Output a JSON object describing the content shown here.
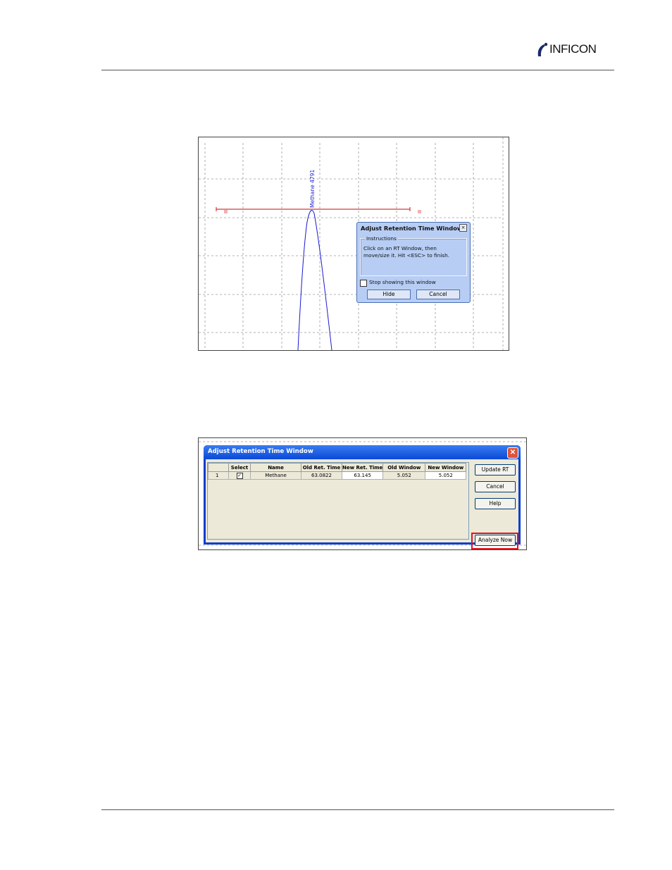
{
  "header": {
    "logo_text": "INFICON"
  },
  "figure1": {
    "peak_label": "Methane  4791",
    "dialog": {
      "title": "Adjust Retention Time Window",
      "close_glyph": "×",
      "group_label": "Instructions",
      "instructions": "Click on an RT Window, then move/size it.  Hit <ESC> to finish.",
      "checkbox_label": "Stop showing this window",
      "hide_label": "Hide",
      "cancel_label": "Cancel"
    }
  },
  "figure2": {
    "window_title": "Adjust Retention Time Window",
    "close_glyph": "✕",
    "columns": [
      "",
      "Select",
      "Name",
      "Old Ret. Time",
      "New Ret. Time",
      "Old Window",
      "New Window"
    ],
    "rows": [
      {
        "num": "1",
        "checked": "✓",
        "name": "Methane",
        "old_rt": "63.0822",
        "new_rt": "63.145",
        "old_window": "5.052",
        "new_window": "5.052"
      }
    ],
    "buttons": {
      "update": "Update RT",
      "cancel": "Cancel",
      "help": "Help",
      "analyze": "Analyze Now"
    },
    "highlight_color": "#e0141e"
  }
}
